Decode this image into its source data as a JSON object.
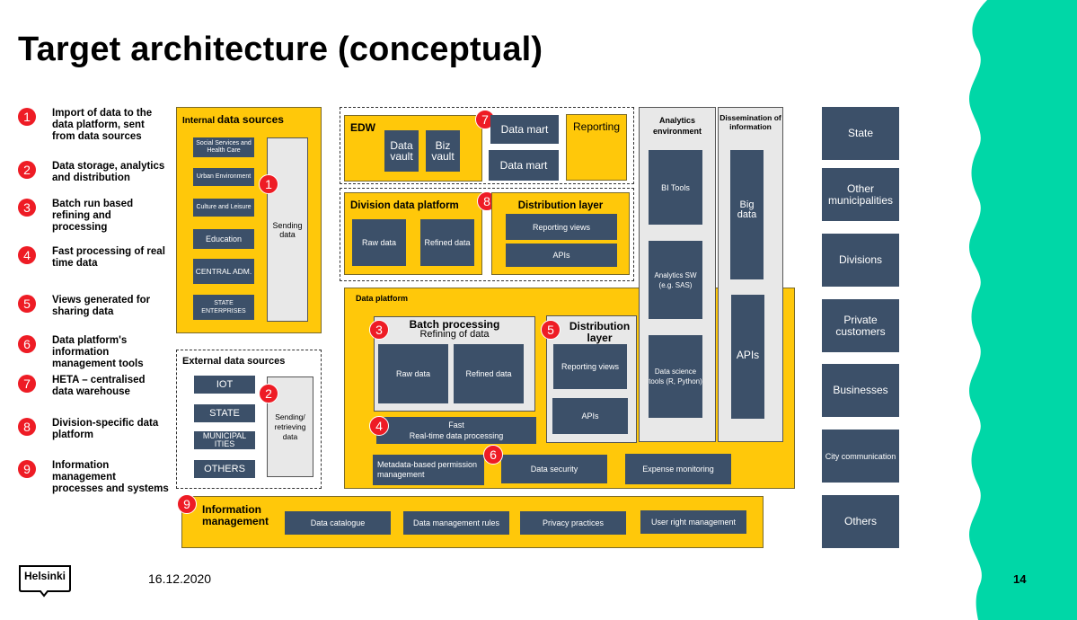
{
  "title": "Target architecture (conceptual)",
  "legend": [
    {
      "num": "1",
      "text": "Import of data to the data platform, sent from data sources"
    },
    {
      "num": "2",
      "text": "Data storage, analytics and distribution"
    },
    {
      "num": "3",
      "text": "Batch run based refining and processing"
    },
    {
      "num": "4",
      "text": "Fast processing of real time data"
    },
    {
      "num": "5",
      "text": "Views generated for sharing data"
    },
    {
      "num": "6",
      "text": "Data platform's information management tools"
    },
    {
      "num": "7",
      "text": "HETA – centralised data warehouse"
    },
    {
      "num": "8",
      "text": "Division-specific data platform"
    },
    {
      "num": "9",
      "text": "Information management processes and systems"
    }
  ],
  "internal_sources": {
    "title_small": "Internal",
    "title_big": "data sources",
    "items": [
      "Social Services and Health Care",
      "Urban Environment",
      "Culture and Leisure",
      "Education",
      "CENTRAL ADM.",
      "STATE ENTERPRISES"
    ],
    "sending": "Sending data",
    "badge": "1"
  },
  "external_sources": {
    "title": "External data sources",
    "items": [
      "IOT",
      "STATE",
      "MUNICIPAL ITIES",
      "OTHERS"
    ],
    "sending": "Sending/ retrieving data",
    "badge": "2"
  },
  "edw": {
    "title": "EDW",
    "items": [
      "Data vault",
      "Biz vault"
    ],
    "badge": "7",
    "marts": [
      "Data mart",
      "Data mart"
    ],
    "reporting": "Reporting"
  },
  "division": {
    "title": "Division data platform",
    "items": [
      "Raw data",
      "Refined data"
    ],
    "badge": "8",
    "distribution_title": "Distribution layer",
    "distribution_items": [
      "Reporting views",
      "APIs"
    ]
  },
  "data_platform": {
    "title": "Data platform",
    "batch_title": "Batch processing",
    "batch_subtitle": "Refining of data",
    "batch_items": [
      "Raw data",
      "Refined data"
    ],
    "batch_badge": "3",
    "dist_title": "Distribution layer",
    "dist_items": [
      "Reporting views",
      "APIs"
    ],
    "dist_badge": "5",
    "fast_line1": "Fast",
    "fast_line2": "Real-time data processing",
    "fast_badge": "4",
    "tools": [
      "Metadata-based permission management",
      "Data security",
      "Expense monitoring"
    ],
    "tools_badge": "6"
  },
  "analytics": {
    "title": "Analytics environment",
    "items": [
      "BI Tools",
      "Analytics SW (e.g. SAS)",
      "Data science tools (R, Python)"
    ]
  },
  "dissemination": {
    "title": "Dissemination of information",
    "items": [
      "Big data",
      "APIs"
    ]
  },
  "info_mgmt": {
    "title": "Information management",
    "badge": "9",
    "items": [
      "Data catalogue",
      "Data management rules",
      "Privacy practices",
      "User right management"
    ]
  },
  "consumers": [
    "State",
    "Other municipalities",
    "Divisions",
    "Private customers",
    "Businesses",
    "City communication",
    "Others"
  ],
  "footer": {
    "logo": "Helsinki",
    "date": "16.12.2020",
    "page": "14"
  },
  "colors": {
    "yellow": "#ffc80a",
    "navy": "#3c5069",
    "red": "#ee1c25",
    "green": "#00d7a7",
    "grey": "#e8e8e8"
  }
}
